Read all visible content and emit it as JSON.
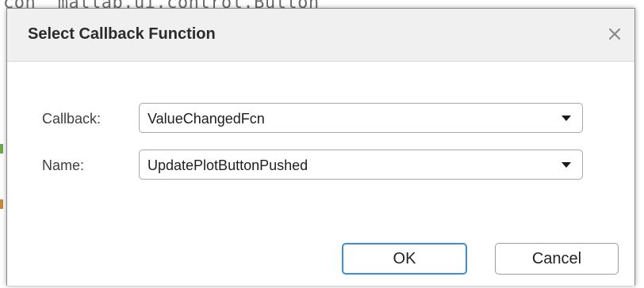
{
  "background": {
    "code_line": "con  matlab.ui.control.Button"
  },
  "dialog": {
    "title": "Select Callback Function",
    "close_icon": "close-icon",
    "fields": [
      {
        "label": "Callback:",
        "value": "ValueChangedFcn"
      },
      {
        "label": "Name:",
        "value": "UpdatePlotButtonPushed"
      }
    ],
    "buttons": {
      "ok_label": "OK",
      "cancel_label": "Cancel"
    }
  },
  "colors": {
    "focus_border": "#3a8fd8",
    "titlebar_bg": "#f0f0f0"
  }
}
